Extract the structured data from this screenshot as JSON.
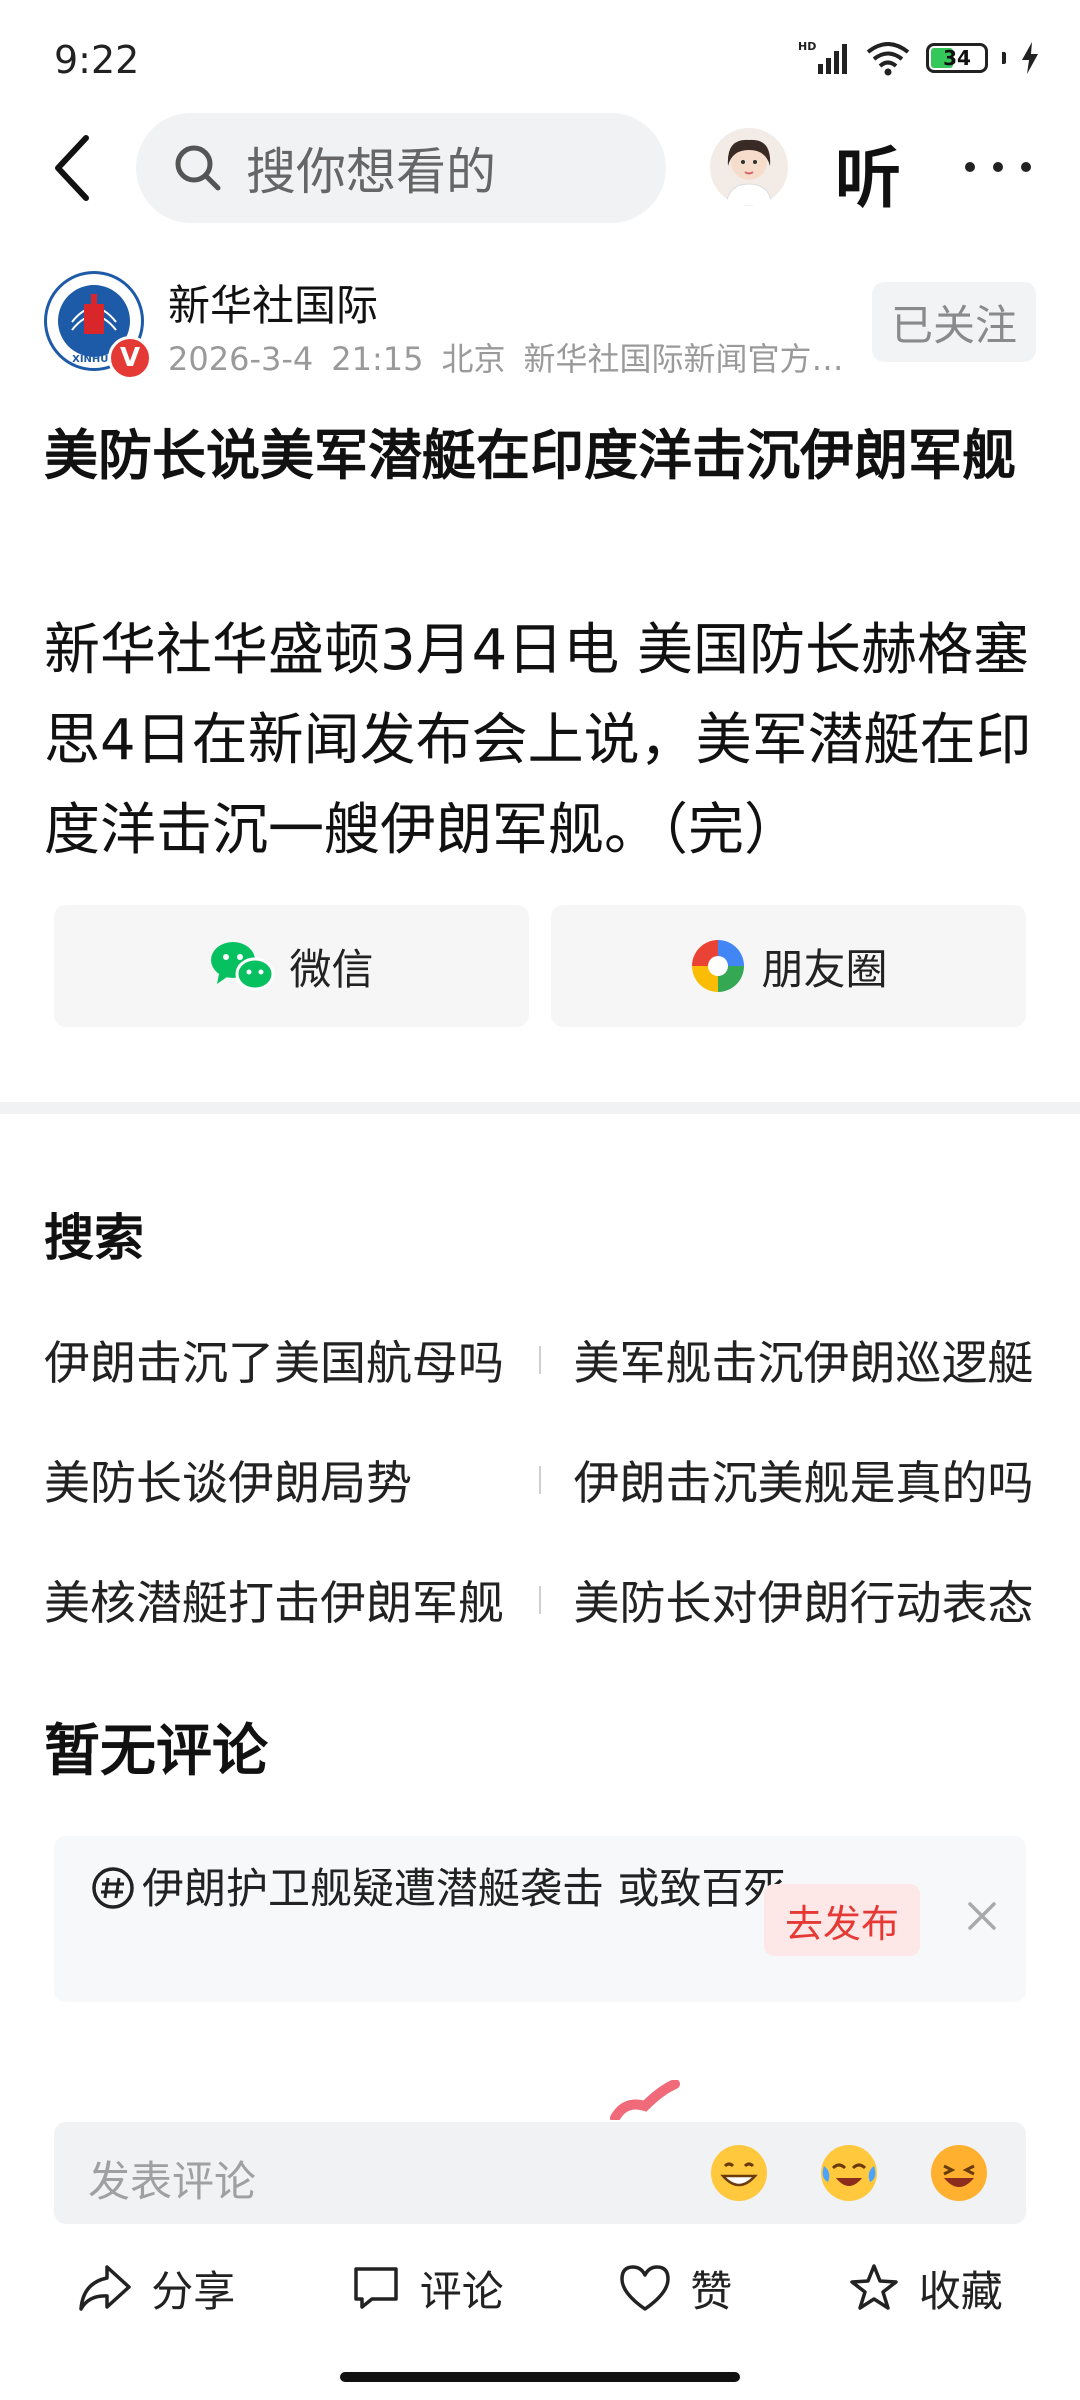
{
  "status_bar": {
    "time": "9:22",
    "battery": "34",
    "network": "HD"
  },
  "nav": {
    "search_placeholder": "搜你想看的",
    "listen_label": "听"
  },
  "author": {
    "name": "新华社国际",
    "date": "2026-3-4",
    "time": "21:15",
    "location": "北京",
    "description": "新华社国际新闻官方账...",
    "follow_label": "已关注",
    "logo_text": "XINHUA"
  },
  "article": {
    "title": "美防长说美军潜艇在印度洋击沉伊朗军舰",
    "body": "新华社华盛顿3月4日电 美国防长赫格塞思4日在新闻发布会上说，美军潜艇在印度洋击沉一艘伊朗军舰。（完）"
  },
  "share": {
    "wechat_label": "微信",
    "moments_label": "朋友圈"
  },
  "search_section": {
    "title": "搜索",
    "items": [
      "伊朗击沉了美国航母吗",
      "美军舰击沉伊朗巡逻艇",
      "美防长谈伊朗局势",
      "伊朗击沉美舰是真的吗",
      "美核潜艇打击伊朗军舰",
      "美防长对伊朗行动表态"
    ]
  },
  "comments": {
    "empty_label": "暂无评论"
  },
  "topic": {
    "text": "伊朗护卫舰疑遭潜艇袭击 或致百死",
    "publish_label": "去发布"
  },
  "comment_input": {
    "placeholder": "发表评论"
  },
  "bottom_bar": {
    "share_label": "分享",
    "comment_label": "评论",
    "like_label": "赞",
    "favorite_label": "收藏"
  },
  "colors": {
    "accent_red": "#e53935",
    "wechat_green": "#07c160",
    "follow_bg": "#f2f3f5"
  }
}
